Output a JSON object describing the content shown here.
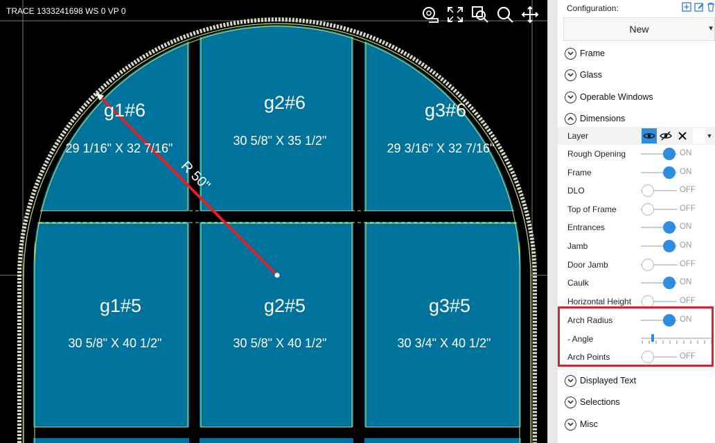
{
  "canvas": {
    "trace_text": "TRACE 1333241698  WS 0  VP 0",
    "radius_label": "R 50\"",
    "toolbar": [
      "measure-tape-icon",
      "fit-screen-icon",
      "zoom-window-icon",
      "zoom-icon",
      "pan-icon"
    ],
    "panes": [
      {
        "id": "g1#6",
        "size": "29 1/16\" X 32 7/16\""
      },
      {
        "id": "g2#6",
        "size": "30 5/8\" X 35 1/2\""
      },
      {
        "id": "g3#6",
        "size": "29 3/16\" X 32 7/16\""
      },
      {
        "id": "g1#5",
        "size": "30 5/8\" X 40 1/2\""
      },
      {
        "id": "g2#5",
        "size": "30 5/8\" X 40 1/2\""
      },
      {
        "id": "g3#5",
        "size": "30 3/4\" X 40 1/2\""
      }
    ],
    "colors": {
      "glass": "#00739c",
      "frame_line": "#c8e05a",
      "radius_line": "#e0202a"
    }
  },
  "panel": {
    "configuration_label": "Configuration:",
    "configuration_icons": [
      "add-icon",
      "edit-icon",
      "delete-icon"
    ],
    "configuration_value": "New",
    "sections_top": [
      "Frame",
      "Glass",
      "Operable Windows",
      "Dimensions"
    ],
    "layer_label": "Layer",
    "layer_icons": [
      "eye-icon",
      "eye-slash-icon",
      "close-icon"
    ],
    "rows": [
      {
        "label": "Rough Opening",
        "state": "ON",
        "on": true
      },
      {
        "label": "Frame",
        "state": "ON",
        "on": true
      },
      {
        "label": "DLO",
        "state": "OFF",
        "on": false
      },
      {
        "label": "Top of Frame",
        "state": "OFF",
        "on": false
      },
      {
        "label": "Entrances",
        "state": "ON",
        "on": true
      },
      {
        "label": "Jamb",
        "state": "ON",
        "on": true
      },
      {
        "label": "Door Jamb",
        "state": "OFF",
        "on": false
      },
      {
        "label": "Caulk",
        "state": "ON",
        "on": true
      },
      {
        "label": "Horizontal Height",
        "state": "OFF",
        "on": false
      },
      {
        "label": "Arch Radius",
        "state": "ON",
        "on": true
      }
    ],
    "angle_label": " - Angle",
    "angle_value": 0.15,
    "arch_points": {
      "label": "Arch Points",
      "state": "OFF",
      "on": false
    },
    "sections_bottom": [
      "Displayed Text",
      "Selections",
      "Misc"
    ],
    "highlight_color": "#d9232e"
  }
}
